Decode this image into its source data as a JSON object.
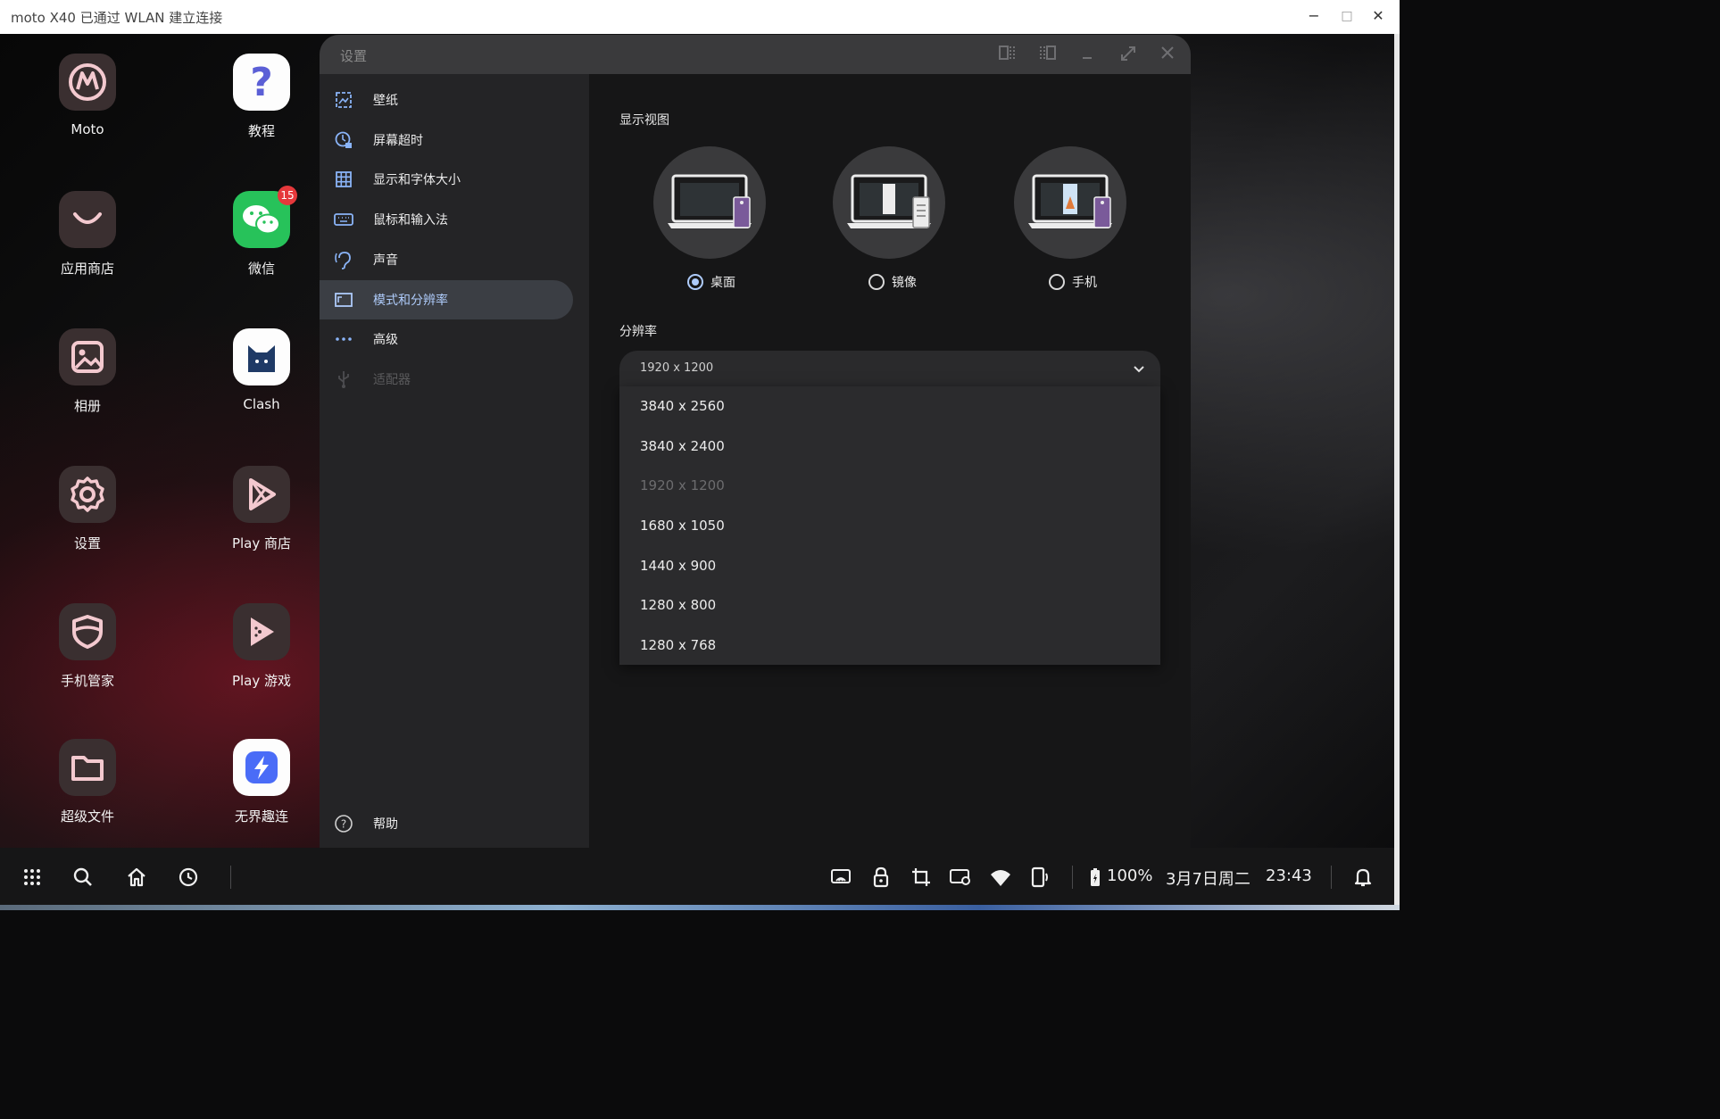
{
  "host_window": {
    "title": "moto X40 已通过 WLAN 建立连接",
    "buttons": {
      "minimize": "−",
      "maximize": "□",
      "close": "✕"
    }
  },
  "desktop_apps": [
    {
      "name": "Moto",
      "icon": "motorola-logo-icon"
    },
    {
      "name": "教程",
      "icon": "question-mark-icon"
    },
    {
      "name": "应用商店",
      "icon": "smile-bag-icon"
    },
    {
      "name": "微信",
      "icon": "wechat-icon",
      "badge": "15"
    },
    {
      "name": "相册",
      "icon": "photo-icon"
    },
    {
      "name": "Clash",
      "icon": "cat-icon"
    },
    {
      "name": "设置",
      "icon": "gear-icon"
    },
    {
      "name": "Play 商店",
      "icon": "play-store-icon"
    },
    {
      "name": "手机管家",
      "icon": "shield-icon"
    },
    {
      "name": "Play 游戏",
      "icon": "play-games-icon"
    },
    {
      "name": "超级文件",
      "icon": "folder-icon"
    },
    {
      "name": "无界趣连",
      "icon": "lightning-icon"
    }
  ],
  "settings": {
    "title": "设置",
    "nav": [
      {
        "label": "壁纸",
        "icon": "wallpaper-icon"
      },
      {
        "label": "屏幕超时",
        "icon": "screen-timeout-icon"
      },
      {
        "label": "显示和字体大小",
        "icon": "grid-icon"
      },
      {
        "label": "鼠标和输入法",
        "icon": "keyboard-icon"
      },
      {
        "label": "声音",
        "icon": "ear-icon"
      },
      {
        "label": "模式和分辨率",
        "icon": "display-mode-icon",
        "active": true
      },
      {
        "label": "高级",
        "icon": "more-dots-icon"
      },
      {
        "label": "适配器",
        "icon": "usb-icon",
        "disabled": true
      }
    ],
    "help": "帮助",
    "content": {
      "display_view_label": "显示视图",
      "views": [
        {
          "label": "桌面",
          "selected": true
        },
        {
          "label": "镜像",
          "selected": false
        },
        {
          "label": "手机",
          "selected": false
        }
      ],
      "resolution_label": "分辨率",
      "resolution_selected": "1920 x 1200",
      "resolution_options": [
        {
          "label": "3840 x 2560",
          "disabled": false
        },
        {
          "label": "3840 x 2400",
          "disabled": false
        },
        {
          "label": "1920 x 1200",
          "disabled": true
        },
        {
          "label": "1680 x 1050",
          "disabled": false
        },
        {
          "label": "1440 x 900",
          "disabled": false
        },
        {
          "label": "1280 x 800",
          "disabled": false
        },
        {
          "label": "1280 x 768",
          "disabled": false
        }
      ]
    }
  },
  "taskbar": {
    "battery": "100%",
    "date": "3月7日周二",
    "time": "23:43"
  },
  "colors": {
    "accent": "#aecbfa",
    "badge": "#e5383b",
    "wechat": "#27c25a"
  }
}
